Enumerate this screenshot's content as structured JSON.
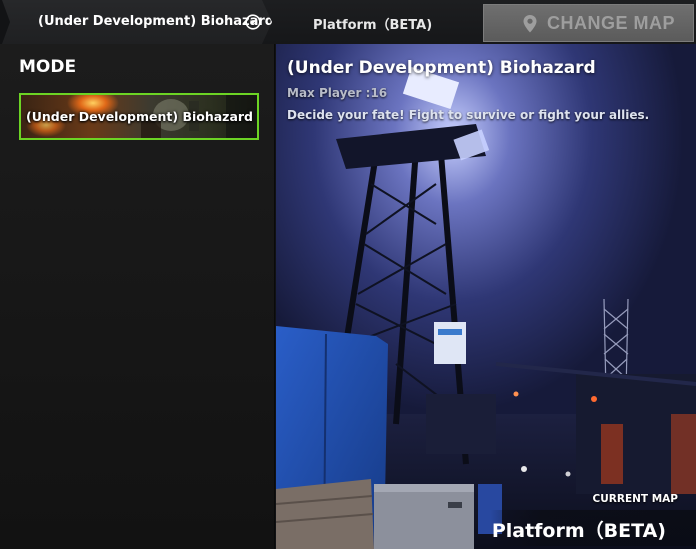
{
  "topbar": {
    "mode_label": "(Under Development) Biohazard",
    "map_label": "Platform（BETA)",
    "change_map_label": "CHANGE MAP"
  },
  "sidebar": {
    "title": "MODE",
    "modes": [
      {
        "label": "(Under Development) Biohazard",
        "selected": true
      }
    ]
  },
  "map": {
    "title": "(Under Development) Biohazard",
    "max_player": "Max Player :16",
    "description": "Decide your fate! Fight to survive or fight your allies."
  },
  "current_map": {
    "caption": "CURRENT MAP",
    "name": "Platform（BETA)"
  },
  "colors": {
    "selected_border": "#6cd424",
    "change_map_bg": "#686868",
    "change_map_text": "#9e9e9e",
    "scene_sky": "#2a3266"
  },
  "icons": {
    "dropdown": "chevron-down-circle-icon",
    "change_map": "map-pin-icon"
  }
}
